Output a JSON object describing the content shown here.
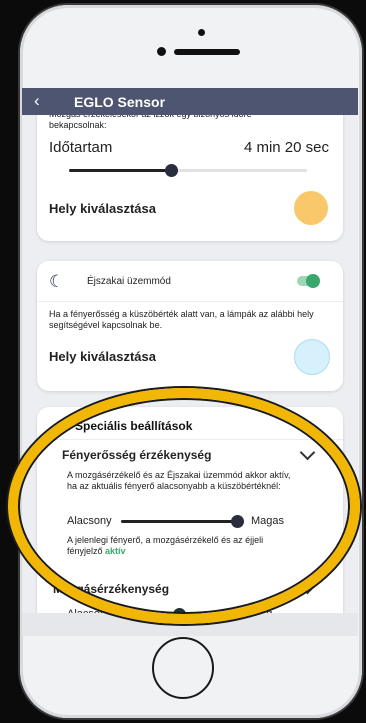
{
  "app": {
    "title": "EGLO Sensor",
    "back_glyph": "‹"
  },
  "motion_card": {
    "cut_text": "Mozgás érzékelésekor az izzók egy bizonyos időre bekapcsolnak:",
    "duration_label": "Időtartam",
    "duration_value": "4 min 20 sec",
    "duration_level": 0.43,
    "location_label": "Hely kiválasztása",
    "location_color": "#f9c86a"
  },
  "night_card": {
    "title": "Éjszakai üzemmód",
    "toggle_on": true,
    "description": "Ha a fényerősség a küszöbérték alatt van, a lámpák az alábbi hely segítségével kapcsolnak be.",
    "location_label": "Hely kiválasztása",
    "location_color": "#d6f1fb"
  },
  "special": {
    "title": "Speciális beállítások",
    "brightness": {
      "title": "Fényerősség érzékenység",
      "description": "A mozgásérzékelő és az Éjszakai üzemmód akkor aktív, ha az aktuális fényerő alacsonyabb a küszöbértéknél:",
      "low_label": "Alacsony",
      "high_label": "Magas",
      "level": 1.0,
      "status_prefix": "A jelenlegi fényerő, a mozgásérzékelő és az éjjeli fényjelző",
      "status_value": "aktív"
    },
    "motion_sensitivity": {
      "title": "Mozgásérzékenység",
      "low_label": "Alacsony",
      "high_label": "Mag",
      "level": 0.5
    }
  },
  "colors": {
    "appbar": "#4d5570",
    "active": "#3aa76d",
    "highlight": "#f2b705"
  }
}
